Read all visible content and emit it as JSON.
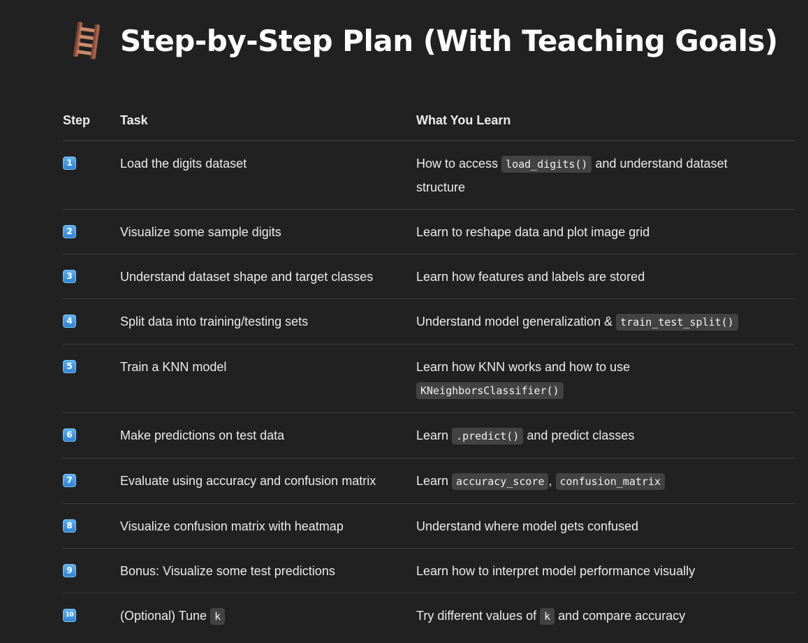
{
  "heading": {
    "icon": "ladder-icon",
    "text": "Step-by-Step Plan (With Teaching Goals)"
  },
  "table": {
    "headers": {
      "step": "Step",
      "task": "Task",
      "learn": "What You Learn"
    },
    "rows": [
      {
        "step": "1",
        "task": [
          "Load the digits dataset"
        ],
        "learn": [
          "How to access ",
          {
            "code": "load_digits()"
          },
          " and understand dataset structure"
        ]
      },
      {
        "step": "2",
        "task": [
          "Visualize some sample digits"
        ],
        "learn": [
          "Learn to reshape data and plot image grid"
        ]
      },
      {
        "step": "3",
        "task": [
          "Understand dataset shape and target classes"
        ],
        "learn": [
          "Learn how features and labels are stored"
        ]
      },
      {
        "step": "4",
        "task": [
          "Split data into training/testing sets"
        ],
        "learn": [
          "Understand model generalization & ",
          {
            "code": "train_test_split()"
          }
        ]
      },
      {
        "step": "5",
        "task": [
          "Train a KNN model"
        ],
        "learn": [
          "Learn how KNN works and how to use ",
          {
            "code": "KNeighborsClassifier()"
          }
        ]
      },
      {
        "step": "6",
        "task": [
          "Make predictions on test data"
        ],
        "learn": [
          "Learn ",
          {
            "code": ".predict()"
          },
          " and predict classes"
        ]
      },
      {
        "step": "7",
        "task": [
          "Evaluate using accuracy and confusion matrix"
        ],
        "learn": [
          "Learn ",
          {
            "code": "accuracy_score"
          },
          ", ",
          {
            "code": "confusion_matrix"
          }
        ]
      },
      {
        "step": "8",
        "task": [
          "Visualize confusion matrix with heatmap"
        ],
        "learn": [
          "Understand where model gets confused"
        ]
      },
      {
        "step": "9",
        "task": [
          "Bonus: Visualize some test predictions"
        ],
        "learn": [
          "Learn how to interpret model performance visually"
        ]
      },
      {
        "step": "10",
        "task": [
          "(Optional) Tune ",
          {
            "code": "k"
          }
        ],
        "learn": [
          "Try different values of ",
          {
            "code": "k"
          },
          " and compare accuracy"
        ]
      }
    ]
  }
}
